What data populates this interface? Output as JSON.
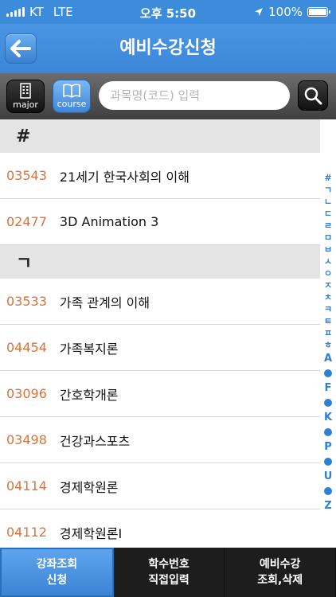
{
  "status_bar": {
    "carrier": "KT",
    "network": "LTE",
    "time": "오후 5:50",
    "battery": "100%"
  },
  "header": {
    "title": "예비수강신청",
    "back_icon": "arrow-left-icon"
  },
  "search": {
    "major_label": "major",
    "course_label": "course",
    "placeholder": "과목명(코드) 입력",
    "value": ""
  },
  "list": {
    "sections": [
      {
        "header": "#",
        "items": [
          {
            "code": "03543",
            "name": "21세기 한국사회의 이해"
          },
          {
            "code": "02477",
            "name": "3D Animation 3"
          }
        ]
      },
      {
        "header": "ㄱ",
        "items": [
          {
            "code": "03533",
            "name": "가족 관계의 이해"
          },
          {
            "code": "04454",
            "name": "가족복지론"
          },
          {
            "code": "03096",
            "name": "간호학개론"
          },
          {
            "code": "03498",
            "name": "건강과스포츠"
          },
          {
            "code": "04114",
            "name": "경제학원론"
          },
          {
            "code": "04112",
            "name": "경제학원론I"
          }
        ]
      }
    ]
  },
  "index_bar": {
    "items": [
      "#",
      "ㄱ",
      "ㄴ",
      "ㄷ",
      "ㄹ",
      "ㅁ",
      "ㅂ",
      "ㅅ",
      "ㅇ",
      "ㅈ",
      "ㅊ",
      "ㅋ",
      "ㅌ",
      "ㅍ",
      "ㅎ",
      "A",
      "•",
      "F",
      "•",
      "K",
      "•",
      "P",
      "•",
      "U",
      "•",
      "Z"
    ]
  },
  "tabs": [
    {
      "line1": "강좌조회",
      "line2": "신청",
      "active": true
    },
    {
      "line1": "학수번호",
      "line2": "직접입력",
      "active": false
    },
    {
      "line1": "예비수강",
      "line2": "조회,삭제",
      "active": false
    }
  ],
  "colors": {
    "accent": "#3d8bdb",
    "course_code": "#d9733a",
    "index": "#2f7fd6"
  }
}
